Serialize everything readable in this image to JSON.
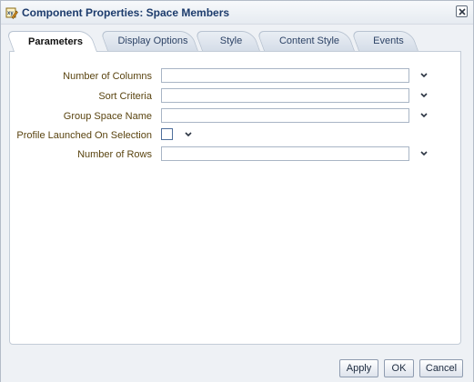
{
  "dialog": {
    "title": "Component Properties: Space Members",
    "icon": "edit-properties-icon",
    "close_icon": "close-icon"
  },
  "tabs": [
    {
      "label": "Parameters",
      "active": true
    },
    {
      "label": "Display Options",
      "active": false
    },
    {
      "label": "Style",
      "active": false
    },
    {
      "label": "Content Style",
      "active": false
    },
    {
      "label": "Events",
      "active": false
    }
  ],
  "parameters": {
    "number_of_columns": {
      "label": "Number of Columns",
      "value": ""
    },
    "sort_criteria": {
      "label": "Sort Criteria",
      "value": ""
    },
    "group_space_name": {
      "label": "Group Space Name",
      "value": ""
    },
    "profile_launched_on_selection": {
      "label": "Profile Launched On Selection",
      "checked": false
    },
    "number_of_rows": {
      "label": "Number of Rows",
      "value": ""
    }
  },
  "footer": {
    "apply_label": "Apply",
    "ok_label": "OK",
    "cancel_label": "Cancel"
  },
  "colors": {
    "title_text": "#1c3b6c",
    "label_text": "#5a4410",
    "panel_bg": "#ffffff",
    "dialog_bg": "#eef1f5"
  }
}
